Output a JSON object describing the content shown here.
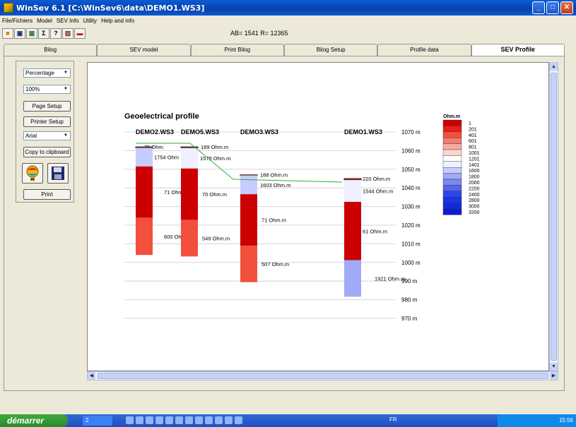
{
  "window": {
    "title": "WinSev 6.1 [C:\\WinSev6\\data\\DEMO1.WS3]",
    "min": "_",
    "max": "□",
    "close": "✕"
  },
  "menu": [
    "File/Fichiers",
    "Model",
    "SEV Info",
    "Utility",
    "Help and info"
  ],
  "toolbar": {
    "ab_readout": "AB= 1541  R= 12365"
  },
  "tabs": [
    "Bilog",
    "SEV model",
    "Print Bilog",
    "Bilog Setup",
    "Profile data",
    "SEV Profile"
  ],
  "left_panel": {
    "scale_mode": "Percentage",
    "zoom": "100%",
    "page_setup": "Page Setup",
    "printer_setup": "Printer Setup",
    "font": "Arial",
    "copy_clipboard": "Copy to clipboard",
    "print": "Print"
  },
  "profile": {
    "title": "Geoelectrical profile",
    "elevation_unit": "m",
    "elevation_labels": [
      "1070 m",
      "1060 m",
      "1050 m",
      "1040 m",
      "1030 m",
      "1020 m",
      "1010 m",
      "1000 m",
      "990 m",
      "980 m",
      "970 m"
    ],
    "soundings": [
      {
        "name": "DEMO2.WS3",
        "layers": [
          {
            "label": "75 Ohm.",
            "resistivity": 75
          },
          {
            "label": "1754 Ohm",
            "resistivity": 1754
          },
          {
            "label": "71 Ohm.",
            "resistivity": 71
          },
          {
            "label": "600 Ohm",
            "resistivity": 600
          }
        ]
      },
      {
        "name": "DEMO5.WS3",
        "layers": [
          {
            "label": "189 Ohm.m",
            "resistivity": 189
          },
          {
            "label": "1578 Ohm.m",
            "resistivity": 1578
          },
          {
            "label": "70 Ohm.m",
            "resistivity": 70
          },
          {
            "label": "549 Ohm.m",
            "resistivity": 549
          }
        ]
      },
      {
        "name": "DEMO3.WS3",
        "layers": [
          {
            "label": "188 Ohm.m",
            "resistivity": 188
          },
          {
            "label": "1603 Ohm.m",
            "resistivity": 1603
          },
          {
            "label": "71 Ohm.m",
            "resistivity": 71
          },
          {
            "label": "507 Ohm.m",
            "resistivity": 507
          }
        ]
      },
      {
        "name": "DEMO1.WS3",
        "layers": [
          {
            "label": "220 Ohm.m",
            "resistivity": 220
          },
          {
            "label": "1544 Ohm.m",
            "resistivity": 1544
          },
          {
            "label": "61 Ohm.m",
            "resistivity": 61
          },
          {
            "label": "1921 Ohm.m",
            "resistivity": 1921
          }
        ]
      }
    ],
    "legend": {
      "title": "Ohm.m",
      "entries": [
        {
          "label": "1",
          "color": "#cc0000"
        },
        {
          "label": "201",
          "color": "#e8201a"
        },
        {
          "label": "401",
          "color": "#f2503c"
        },
        {
          "label": "601",
          "color": "#f47c6c"
        },
        {
          "label": "801",
          "color": "#f8aaa0"
        },
        {
          "label": "1001",
          "color": "#fcd4d0"
        },
        {
          "label": "1201",
          "color": "#ffffff"
        },
        {
          "label": "1401",
          "color": "#eef0ff"
        },
        {
          "label": "1600",
          "color": "#c6ccff"
        },
        {
          "label": "1800",
          "color": "#a0aaf8"
        },
        {
          "label": "2000",
          "color": "#7a88f2"
        },
        {
          "label": "2200",
          "color": "#5466ec"
        },
        {
          "label": "2400",
          "color": "#2e46e8"
        },
        {
          "label": "2800",
          "color": "#1a34e6"
        },
        {
          "label": "3000",
          "color": "#1428e0"
        },
        {
          "label": "3200",
          "color": "#0a1ad8"
        }
      ]
    }
  },
  "taskbar": {
    "start": "démarrer",
    "window_group": "2",
    "lang": "FR",
    "clock": "15:56"
  }
}
